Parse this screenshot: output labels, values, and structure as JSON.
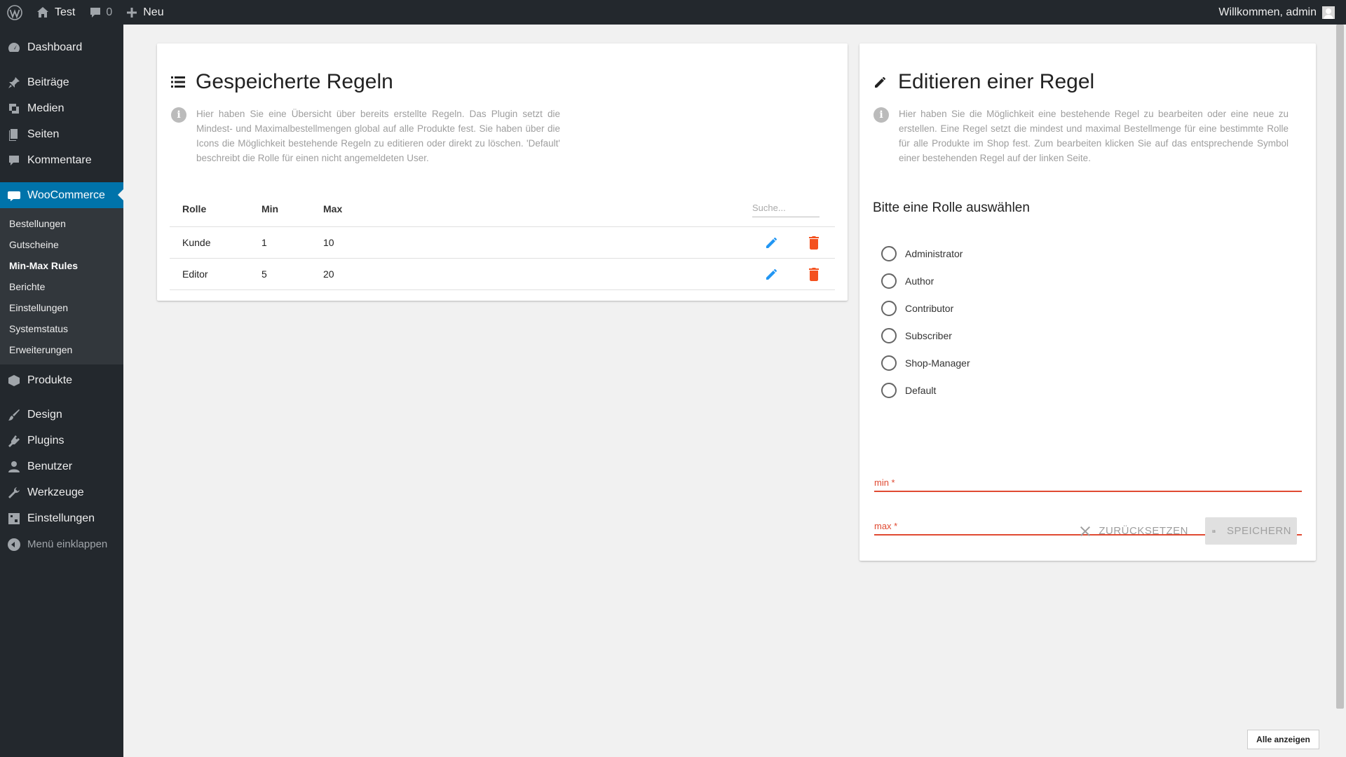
{
  "adminbar": {
    "site_name": "Test",
    "comments_count": "0",
    "new_label": "Neu",
    "welcome": "Willkommen, admin"
  },
  "sidebar": {
    "items_top": [
      {
        "label": "Dashboard",
        "icon": "dashboard-icon"
      },
      {
        "label": "Beiträge",
        "icon": "pin-icon"
      },
      {
        "label": "Medien",
        "icon": "media-icon"
      },
      {
        "label": "Seiten",
        "icon": "pages-icon"
      },
      {
        "label": "Kommentare",
        "icon": "comments-icon"
      }
    ],
    "woocommerce": "WooCommerce",
    "woo_sub": [
      "Bestellungen",
      "Gutscheine",
      "Min-Max Rules",
      "Berichte",
      "Einstellungen",
      "Systemstatus",
      "Erweiterungen"
    ],
    "woo_current": "Min-Max Rules",
    "items_bottom": [
      {
        "label": "Produkte",
        "icon": "products-icon"
      },
      {
        "label": "Design",
        "icon": "brush-icon"
      },
      {
        "label": "Plugins",
        "icon": "plugins-icon"
      },
      {
        "label": "Benutzer",
        "icon": "user-icon"
      },
      {
        "label": "Werkzeuge",
        "icon": "wrench-icon"
      },
      {
        "label": "Einstellungen",
        "icon": "settings-icon"
      }
    ],
    "collapse": "Menü einklappen"
  },
  "rules_card": {
    "title": "Gespeicherte Regeln",
    "info": "Hier haben Sie eine Übersicht über bereits erstellte Regeln. Das Plugin setzt die Mindest- und Maximalbestellmengen global auf alle Produkte fest. Sie haben über die Icons die Möglichkeit bestehende Regeln zu editieren oder direkt zu löschen. 'Default' beschreibt die Rolle für einen nicht angemeldeten User.",
    "columns": {
      "rolle": "Rolle",
      "min": "Min",
      "max": "Max"
    },
    "search_placeholder": "Suche...",
    "rows": [
      {
        "rolle": "Kunde",
        "min": "1",
        "max": "10"
      },
      {
        "rolle": "Editor",
        "min": "5",
        "max": "20"
      }
    ]
  },
  "edit_card": {
    "title": "Editieren einer Regel",
    "info": "Hier haben Sie die Möglichkeit eine bestehende Regel zu bearbeiten oder eine neue zu erstellen. Eine Regel setzt die mindest und maximal Bestellmenge für eine bestimmte Rolle für alle Produkte im Shop fest. Zum bearbeiten klicken Sie auf das entsprechende Symbol einer bestehenden Regel auf der linken Seite.",
    "role_heading": "Bitte eine Rolle auswählen",
    "roles": [
      "Administrator",
      "Author",
      "Contributor",
      "Subscriber",
      "Shop-Manager",
      "Default"
    ],
    "min_label": "min *",
    "max_label": "max *",
    "reset_label": "ZURÜCKSETZEN",
    "save_label": "SPEICHERN"
  },
  "footer": {
    "show_all": "Alle anzeigen"
  },
  "colors": {
    "admin_dark": "#23282d",
    "accent_blue": "#0073aa",
    "edit_blue": "#2196f3",
    "delete_red": "#f4511e",
    "error_red": "#e04a32"
  }
}
